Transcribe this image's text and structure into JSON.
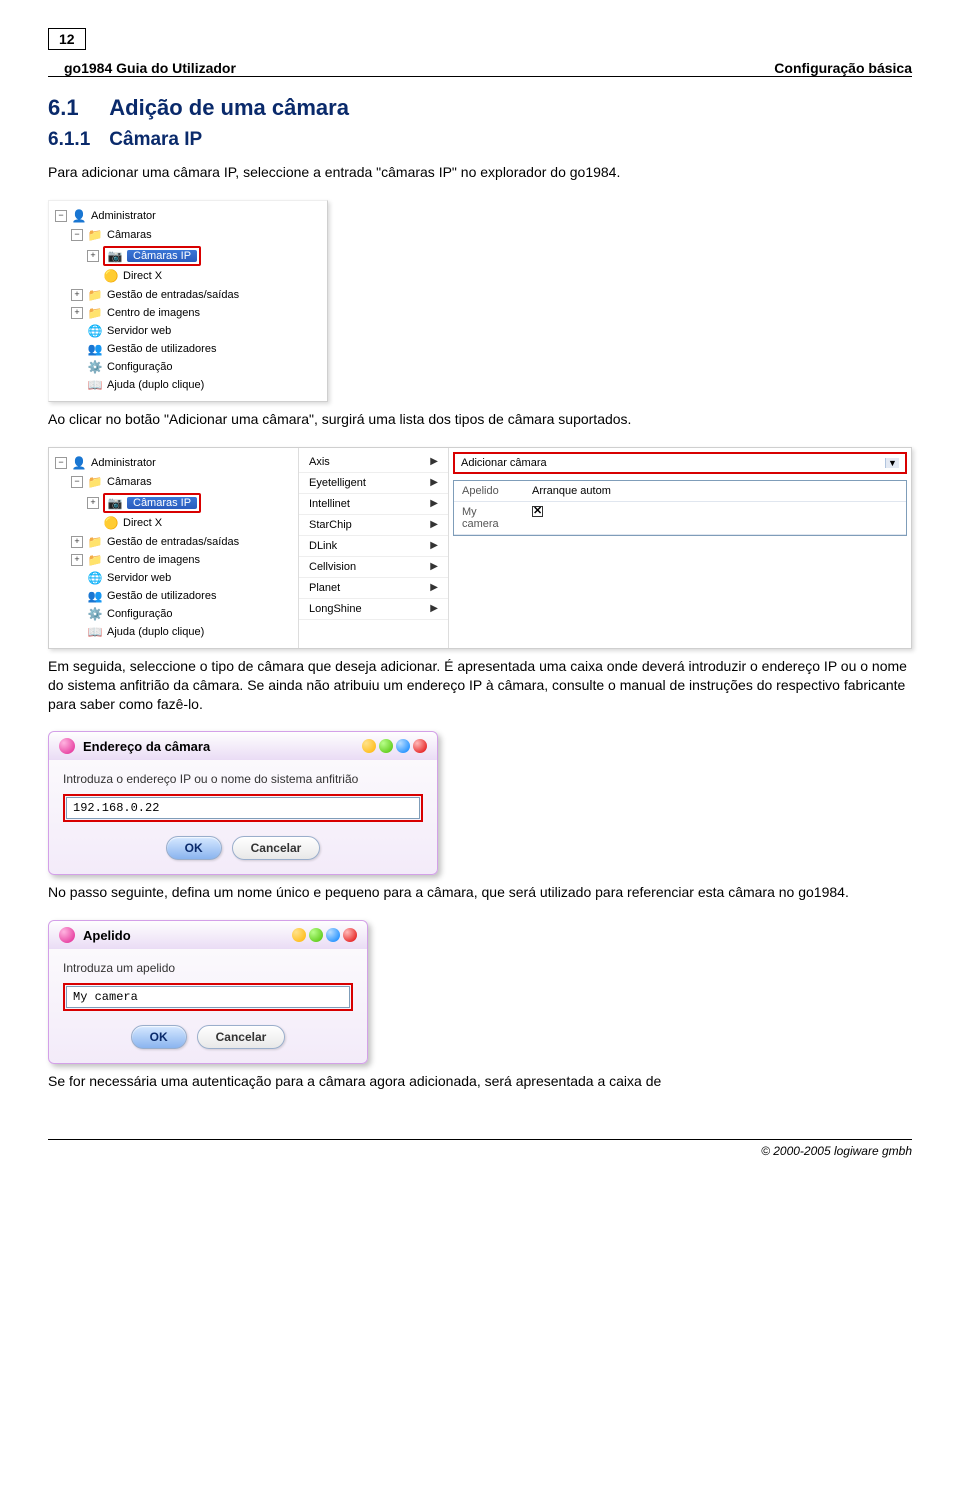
{
  "header": {
    "page_num": "12",
    "doc_title": "go1984 Guia do Utilizador",
    "section_title": "Configuração básica"
  },
  "headings": {
    "h1_num": "6.1",
    "h1_text": "Adição de uma câmara",
    "h2_num": "6.1.1",
    "h2_text": "Câmara IP"
  },
  "para1": "Para adicionar uma câmara IP, seleccione a entrada \"câmaras IP\" no explorador do go1984.",
  "tree1": {
    "root": "Administrator",
    "cameras": "Câmaras",
    "ip_cameras": "Câmaras IP",
    "directx": "Direct X",
    "gestao_es": "Gestão de entradas/saídas",
    "centro_img": "Centro de imagens",
    "servidor_web": "Servidor web",
    "gestao_util": "Gestão de utilizadores",
    "config": "Configuração",
    "ajuda": "Ajuda (duplo clique)"
  },
  "para2": "Ao clicar no botão \"Adicionar uma câmara\", surgirá uma lista dos tipos de câmara suportados.",
  "shot2": {
    "brands": [
      "Axis",
      "Eyetelligent",
      "Intellinet",
      "StarChip",
      "DLink",
      "Cellvision",
      "Planet",
      "LongShine"
    ],
    "combo": "Adicionar câmara",
    "rec_label1": "Apelido",
    "rec_label2": "Arranque autom",
    "rec_val1": "My camera"
  },
  "para3": "Em seguida, seleccione o tipo de câmara que deseja adicionar. É apresentada uma caixa onde deverá introduzir o endereço IP ou o nome do sistema anfitrião da câmara. Se ainda não atribuiu um endereço IP à câmara, consulte o manual de instruções do respectivo fabricante para saber como fazê-lo.",
  "dlg1": {
    "title": "Endereço da câmara",
    "instr": "Introduza o endereço IP ou o nome do sistema anfitrião",
    "value": "192.168.0.22",
    "ok": "OK",
    "cancel": "Cancelar"
  },
  "para4": "No passo seguinte, defina um nome único e pequeno para a câmara, que será utilizado para referenciar esta câmara no go1984.",
  "dlg2": {
    "title": "Apelido",
    "instr": "Introduza um apelido",
    "value": "My camera",
    "ok": "OK",
    "cancel": "Cancelar"
  },
  "para5": "Se for necessária uma autenticação para a câmara agora adicionada, será apresentada a caixa de",
  "footer": "© 2000-2005 logiware gmbh"
}
